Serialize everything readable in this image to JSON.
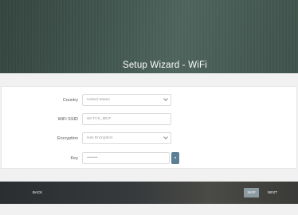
{
  "header": {
    "title": "Setup Wizard - WiFi"
  },
  "form": {
    "country": {
      "label": "Country",
      "value": "United States"
    },
    "ssid": {
      "label": "WiFi SSID",
      "value": "Wi-TCK_IBCF"
    },
    "encryption": {
      "label": "Encryption",
      "value": "Has Encryption"
    },
    "key": {
      "label": "Key",
      "value": "••••••••"
    }
  },
  "footer": {
    "back_label": "BACK",
    "skip_label": "SKIP",
    "next_label": "NEXT"
  },
  "colors": {
    "accent": "#5b7f94",
    "skip_bg": "#8c9aa2"
  }
}
